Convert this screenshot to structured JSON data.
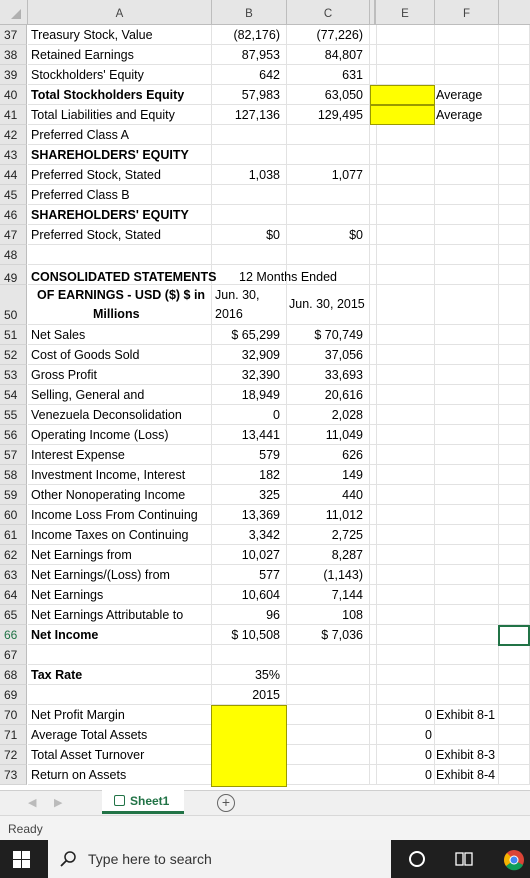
{
  "columns": [
    "A",
    "B",
    "C",
    "E",
    "F"
  ],
  "rows": [
    {
      "n": "37",
      "a": "Treasury Stock, Value",
      "b": "(82,176)",
      "c": "(77,226)"
    },
    {
      "n": "38",
      "a": "Retained Earnings",
      "b": "87,953",
      "c": "84,807"
    },
    {
      "n": "39",
      "a": "Stockholders' Equity",
      "b": "642",
      "c": "631"
    },
    {
      "n": "40",
      "a": "Total Stockholders Equity",
      "b": "57,983",
      "c": "63,050",
      "bold": true,
      "f": "Average"
    },
    {
      "n": "41",
      "a": "Total Liabilities and Equity",
      "b": "127,136",
      "c": "129,495",
      "f": "Average"
    },
    {
      "n": "42",
      "a": "Preferred Class A",
      "b": "",
      "c": ""
    },
    {
      "n": "43",
      "a": "SHAREHOLDERS' EQUITY",
      "b": "",
      "c": "",
      "bold": true
    },
    {
      "n": "44",
      "a": "Preferred Stock, Stated",
      "b": "1,038",
      "c": "1,077"
    },
    {
      "n": "45",
      "a": "Preferred Class B",
      "b": "",
      "c": ""
    },
    {
      "n": "46",
      "a": "SHAREHOLDERS' EQUITY",
      "b": "",
      "c": "",
      "bold": true
    },
    {
      "n": "47",
      "a": "Preferred Stock, Stated",
      "b": "$0",
      "c": "$0"
    },
    {
      "n": "48",
      "a": "",
      "b": "",
      "c": ""
    }
  ],
  "row49": {
    "n": "49",
    "a": "CONSOLIDATED STATEMENTS",
    "b": "12 Months Ended"
  },
  "row50": {
    "n": "50",
    "a1": "OF EARNINGS - USD ($) $ in",
    "a2": "Millions",
    "b1": "Jun. 30,",
    "b2": "2016",
    "c": "Jun. 30, 2015"
  },
  "rows2": [
    {
      "n": "51",
      "a": "Net Sales",
      "b": "$ 65,299",
      "c": "$ 70,749"
    },
    {
      "n": "52",
      "a": "Cost of Goods Sold",
      "b": "32,909",
      "c": "37,056"
    },
    {
      "n": "53",
      "a": "Gross Profit",
      "b": "32,390",
      "c": "33,693"
    },
    {
      "n": "54",
      "a": "Selling, General and",
      "b": "18,949",
      "c": "20,616"
    },
    {
      "n": "55",
      "a": "Venezuela Deconsolidation",
      "b": "0",
      "c": "2,028"
    },
    {
      "n": "56",
      "a": "Operating Income (Loss)",
      "b": "13,441",
      "c": "11,049"
    },
    {
      "n": "57",
      "a": "Interest Expense",
      "b": "579",
      "c": "626"
    },
    {
      "n": "58",
      "a": "Investment Income, Interest",
      "b": "182",
      "c": "149"
    },
    {
      "n": "59",
      "a": "Other Nonoperating Income",
      "b": "325",
      "c": "440"
    },
    {
      "n": "60",
      "a": "Income Loss From Continuing",
      "b": "13,369",
      "c": "11,012"
    },
    {
      "n": "61",
      "a": "Income Taxes on Continuing",
      "b": "3,342",
      "c": "2,725"
    },
    {
      "n": "62",
      "a": "Net Earnings from",
      "b": "10,027",
      "c": "8,287"
    },
    {
      "n": "63",
      "a": "Net Earnings/(Loss) from",
      "b": "577",
      "c": "(1,143)"
    },
    {
      "n": "64",
      "a": "Net Earnings",
      "b": "10,604",
      "c": "7,144"
    },
    {
      "n": "65",
      "a": "Net Earnings Attributable to",
      "b": "96",
      "c": "108"
    },
    {
      "n": "66",
      "a": "Net Income",
      "b": "$ 10,508",
      "c": "$ 7,036",
      "bold": true
    },
    {
      "n": "67",
      "a": "",
      "b": "",
      "c": ""
    },
    {
      "n": "68",
      "a": "Tax Rate",
      "b": "35%",
      "c": "",
      "bold": true
    },
    {
      "n": "69",
      "a": "",
      "b": "2015",
      "c": ""
    },
    {
      "n": "70",
      "a": "Net Profit Margin",
      "b": "",
      "c": "",
      "e": "0",
      "f": "Exhibit 8-1"
    },
    {
      "n": "71",
      "a": "Average Total Assets",
      "b": "",
      "c": "",
      "e": "0",
      "f": ""
    },
    {
      "n": "72",
      "a": "Total Asset Turnover",
      "b": "",
      "c": "",
      "e": "0",
      "f": "Exhibit 8-3"
    },
    {
      "n": "73",
      "a": "Return on Assets",
      "b": "",
      "c": "",
      "e": "0",
      "f": "Exhibit 8-4"
    }
  ],
  "sheet_tab": "Sheet1",
  "status": "Ready",
  "search_placeholder": "Type here to search",
  "colors": {
    "accent": "#217346",
    "highlight": "#ffff00"
  }
}
